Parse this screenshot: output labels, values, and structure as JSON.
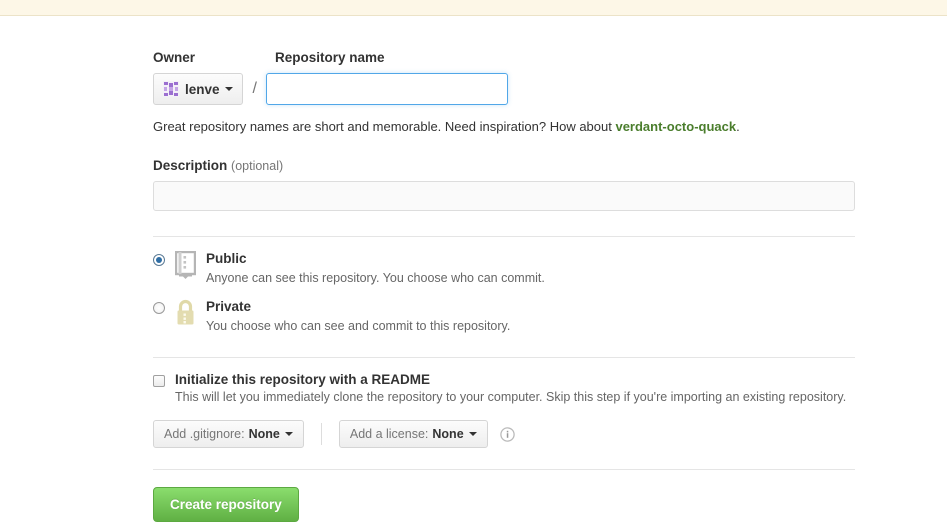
{
  "page": {
    "owner_label": "Owner",
    "repo_name_label": "Repository name",
    "owner_name": "lenve",
    "separator": "/",
    "repo_name_value": "",
    "repo_name_placeholder": "",
    "hint_prefix": "Great repository names are short and memorable. Need inspiration? How about ",
    "hint_suggestion": "verdant-octo-quack",
    "hint_suffix": ".",
    "description_label": "Description",
    "description_optional": "(optional)",
    "description_value": "",
    "description_placeholder": ""
  },
  "visibility": {
    "options": [
      {
        "id": "public",
        "title": "Public",
        "description": "Anyone can see this repository. You choose who can commit.",
        "selected": true,
        "icon": "repo-book-icon"
      },
      {
        "id": "private",
        "title": "Private",
        "description": "You choose who can see and commit to this repository.",
        "selected": false,
        "icon": "lock-icon"
      }
    ]
  },
  "readme": {
    "title": "Initialize this repository with a README",
    "description": "This will let you immediately clone the repository to your computer. Skip this step if you're importing an existing repository.",
    "checked": false
  },
  "dropdowns": {
    "gitignore": {
      "prefix": "Add .gitignore:",
      "value": "None"
    },
    "license": {
      "prefix": "Add a license:",
      "value": "None"
    },
    "info_icon": "info-circle-icon"
  },
  "submit": {
    "create_label": "Create repository"
  },
  "colors": {
    "banner_bg": "#fdf7e7",
    "banner_border": "#ece3c8",
    "focus_border": "#51a7e8",
    "suggestion_green": "#4a7d2c",
    "button_green": "#60b044",
    "identicon_purple": "#9b6fd0",
    "lock_tan": "#e3dcb0",
    "repo_icon_gray": "#b5b5b5"
  }
}
